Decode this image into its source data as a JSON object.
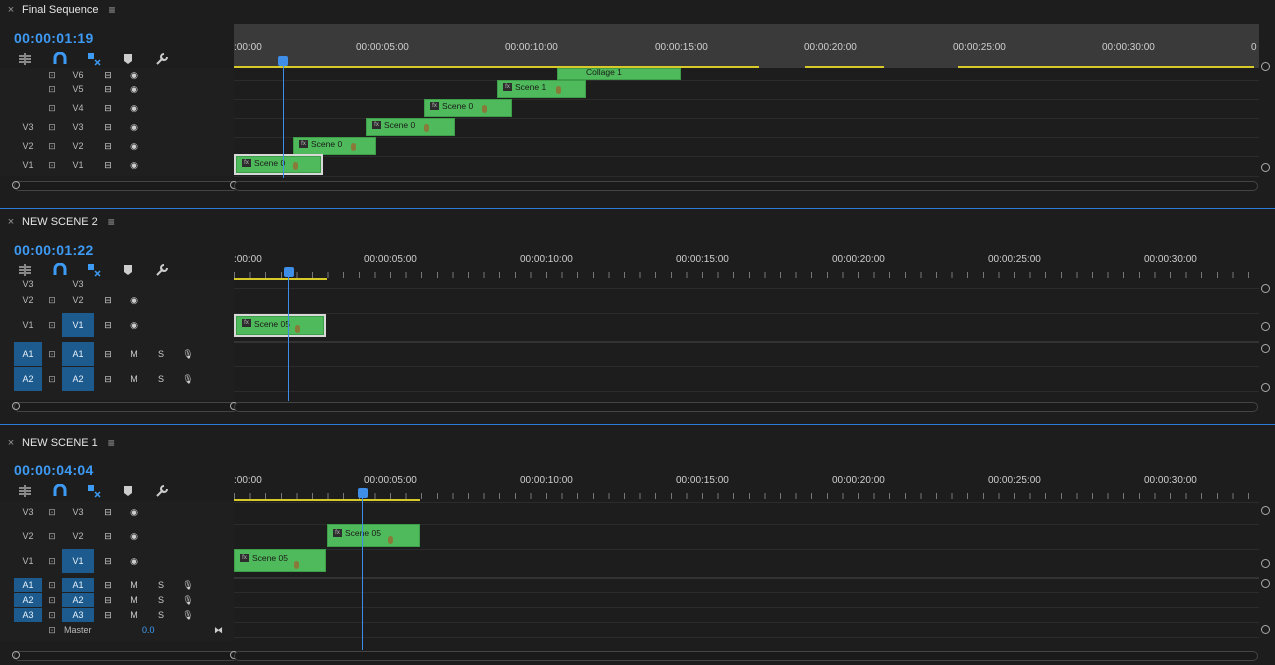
{
  "panels": [
    {
      "title": "Final Sequence",
      "timecode": "00:00:01:19",
      "ruler_ticks": [
        ":00:00",
        "00:00:05:00",
        "00:00:10:00",
        "00:00:15:00",
        "00:00:20:00",
        "00:00:25:00",
        "00:00:30:00",
        "0"
      ],
      "tracks": [
        {
          "src": "",
          "tgt": "V6"
        },
        {
          "src": "",
          "tgt": "V5"
        },
        {
          "src": "",
          "tgt": "V4"
        },
        {
          "src": "V3",
          "tgt": "V3"
        },
        {
          "src": "V2",
          "tgt": "V2"
        },
        {
          "src": "V1",
          "tgt": "V1"
        }
      ],
      "clips": [
        "Collage 1",
        "Scene 1",
        "Scene 0",
        "Scene 0",
        "Scene 0",
        "Scene 0"
      ]
    },
    {
      "title": "NEW SCENE 2",
      "timecode": "00:00:01:22",
      "ruler_ticks": [
        ":00:00",
        "00:00:05:00",
        "00:00:10:00",
        "00:00:15:00",
        "00:00:20:00",
        "00:00:25:00",
        "00:00:30:00"
      ],
      "tracks": [
        {
          "src": "V3",
          "tgt": "V3"
        },
        {
          "src": "V2",
          "tgt": "V2"
        },
        {
          "src": "V1",
          "tgt": "V1"
        },
        {
          "src": "A1",
          "tgt": "A1",
          "m": "M",
          "s": "S"
        },
        {
          "src": "A2",
          "tgt": "A2",
          "m": "M",
          "s": "S"
        }
      ],
      "clips": [
        "Scene 05"
      ]
    },
    {
      "title": "NEW SCENE 1",
      "timecode": "00:00:04:04",
      "ruler_ticks": [
        ":00:00",
        "00:00:05:00",
        "00:00:10:00",
        "00:00:15:00",
        "00:00:20:00",
        "00:00:25:00",
        "00:00:30:00"
      ],
      "tracks": [
        {
          "src": "V3",
          "tgt": "V3"
        },
        {
          "src": "V2",
          "tgt": "V2"
        },
        {
          "src": "V1",
          "tgt": "V1"
        },
        {
          "src": "A1",
          "tgt": "A1",
          "m": "M",
          "s": "S"
        },
        {
          "src": "A2",
          "tgt": "A2",
          "m": "M",
          "s": "S"
        },
        {
          "src": "A3",
          "tgt": "A3",
          "m": "M",
          "s": "S"
        }
      ],
      "clips": [
        "Scene 05",
        "Scene 05"
      ],
      "master": {
        "label": "Master",
        "value": "0.0"
      }
    }
  ],
  "icons": {
    "close": "×",
    "menu": "≡",
    "fx": "fx",
    "lock": "lock-icon",
    "eye": "eye-icon",
    "mic": "mic-icon",
    "film": "film-icon",
    "wrench": "wrench-icon",
    "magnet": "magnet-icon",
    "marker": "marker-icon"
  },
  "colors": {
    "timecode": "#3e9bf5",
    "clip": "#4fba5b",
    "playhead": "#3e8ee8",
    "inout": "#d8c92a",
    "active_track": "#1d5b8e"
  }
}
